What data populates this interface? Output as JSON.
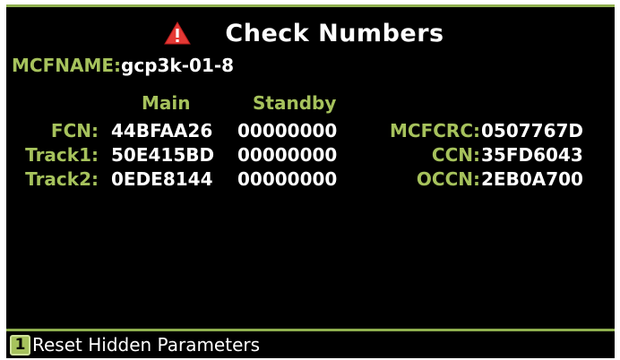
{
  "header": {
    "title": "Check Numbers",
    "icon": "warning-icon"
  },
  "mcfname": {
    "label": "MCFNAME:",
    "value": "gcp3k-01-8"
  },
  "columns": {
    "main": "Main",
    "standby": "Standby"
  },
  "rows": [
    {
      "label": "FCN:",
      "main": "44BFAA26",
      "standby": "00000000",
      "right_label": "MCFCRC:",
      "right_value": "0507767D"
    },
    {
      "label": "Track1:",
      "main": "50E415BD",
      "standby": "00000000",
      "right_label": "CCN:",
      "right_value": "35FD6043"
    },
    {
      "label": "Track2:",
      "main": "0EDE8144",
      "standby": "00000000",
      "right_label": "OCCN:",
      "right_value": "2EB0A700"
    }
  ],
  "footer": {
    "key": "1",
    "label": "Reset Hidden Parameters"
  },
  "colors": {
    "accent": "#a6c25c",
    "background": "#000000",
    "text": "#ffffff",
    "warning": "#e53935"
  }
}
